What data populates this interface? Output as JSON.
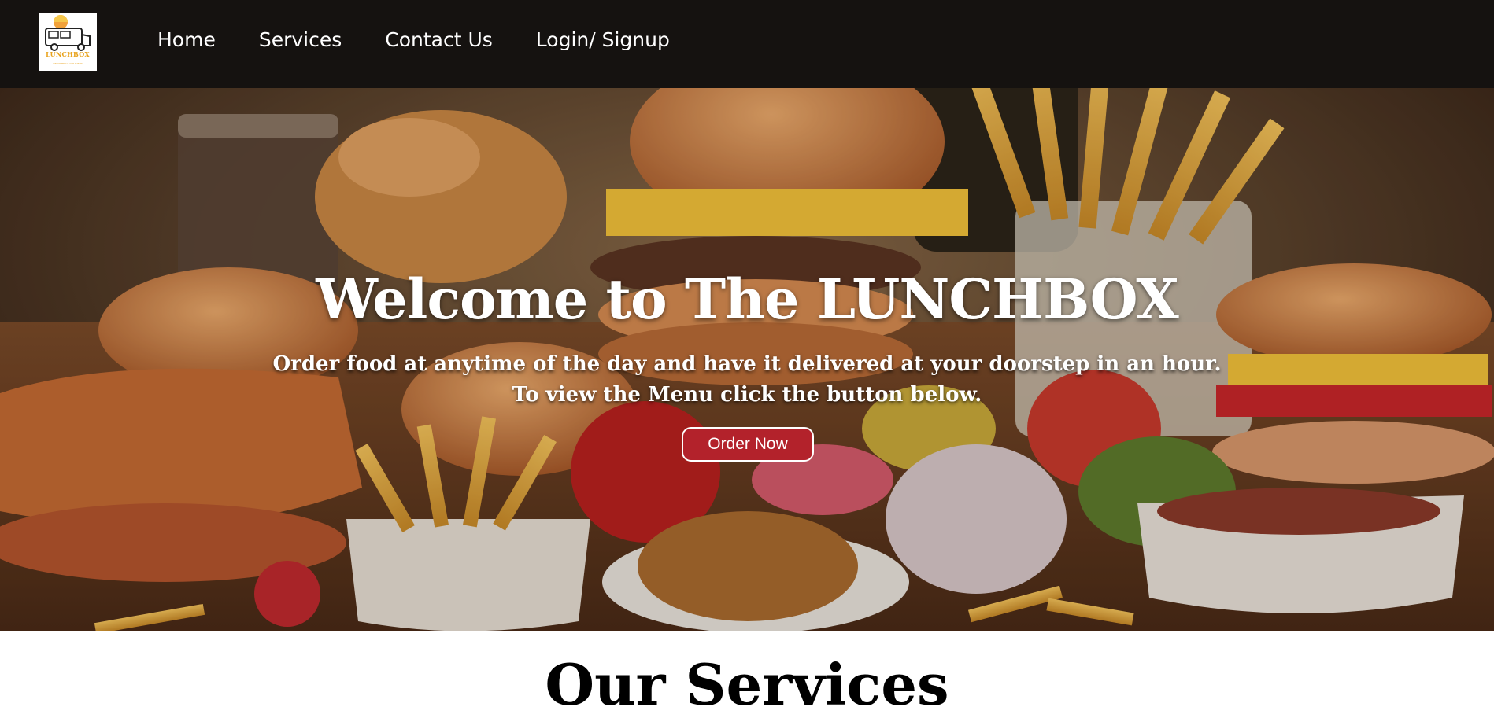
{
  "brand": {
    "logo_text": "LUNCHBOX",
    "logo_subtext": "ON WHEELS DELIVERY"
  },
  "nav": {
    "items": [
      {
        "label": "Home"
      },
      {
        "label": "Services"
      },
      {
        "label": "Contact Us"
      },
      {
        "label": "Login/ Signup"
      }
    ]
  },
  "hero": {
    "title": "Welcome to The LUNCHBOX",
    "line1": "Order food at anytime of the day and have it delivered at your doorstep in an hour.",
    "line2": "To view the Menu click the button below.",
    "cta_label": "Order Now",
    "cta_color": "#b3222b"
  },
  "services": {
    "title": "Our Services"
  },
  "colors": {
    "navbar_bg": "#151210",
    "accent": "#b3222b",
    "logo_accent": "#e8a21b"
  }
}
